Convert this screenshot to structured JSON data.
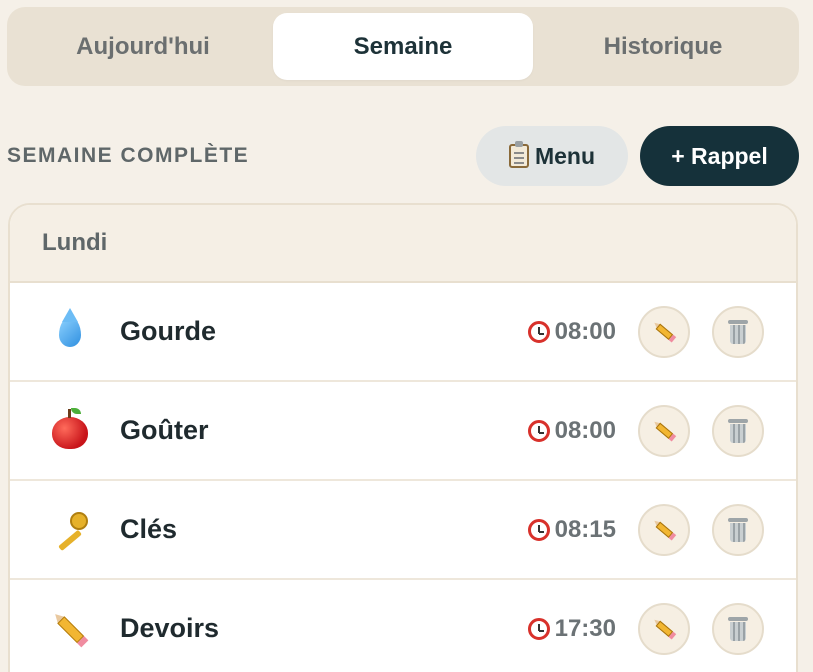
{
  "tabs": [
    {
      "label": "Aujourd'hui",
      "active": false
    },
    {
      "label": "Semaine",
      "active": true
    },
    {
      "label": "Historique",
      "active": false
    }
  ],
  "section": {
    "title": "SEMAINE COMPLÈTE",
    "menu_label": "Menu",
    "add_label": "+ Rappel"
  },
  "day": {
    "name": "Lundi",
    "items": [
      {
        "icon": "water-drop-icon",
        "label": "Gourde",
        "time": "08:00"
      },
      {
        "icon": "apple-icon",
        "label": "Goûter",
        "time": "08:00"
      },
      {
        "icon": "key-icon",
        "label": "Clés",
        "time": "08:15"
      },
      {
        "icon": "pencil-icon",
        "label": "Devoirs",
        "time": "17:30"
      }
    ]
  },
  "colors": {
    "background": "#f5f0e8",
    "primary_button": "#15313a",
    "secondary_button": "#e3e6e6",
    "accent_red": "#d8312b"
  }
}
